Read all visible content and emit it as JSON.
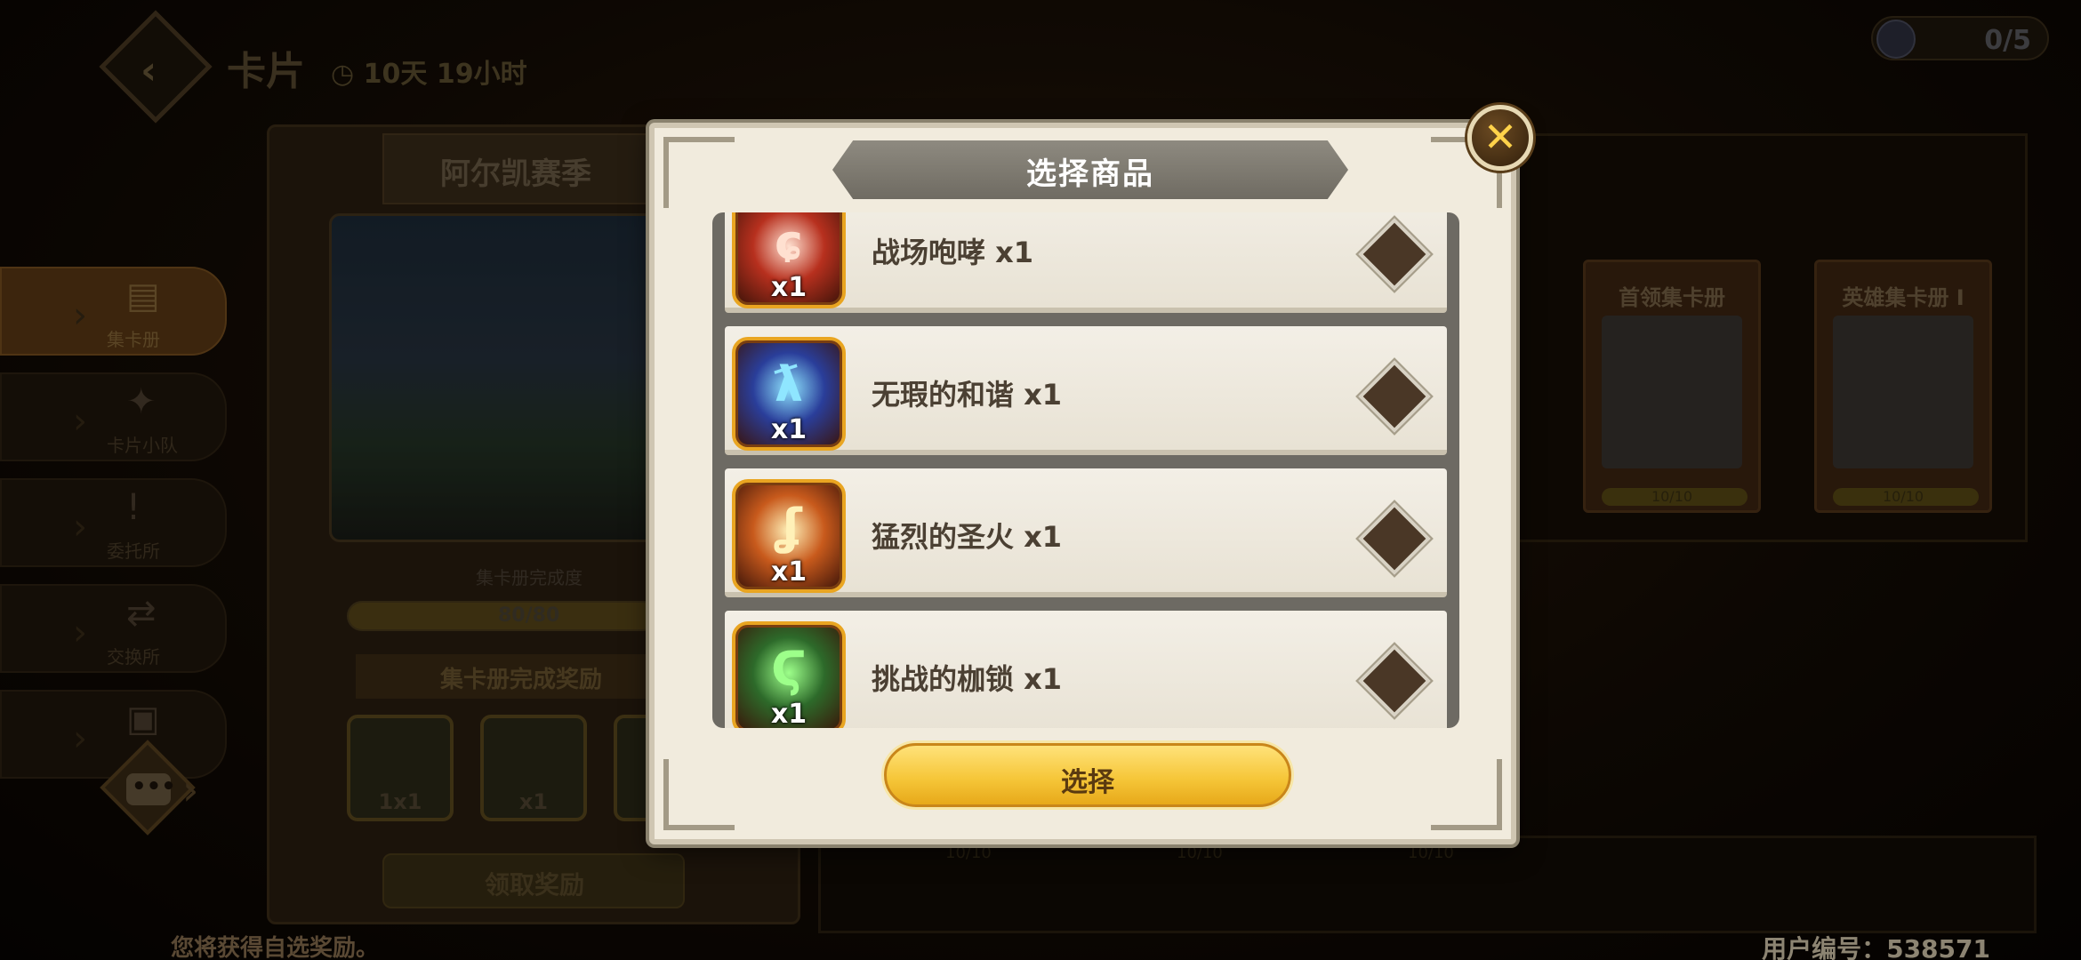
{
  "background": {
    "title": "卡片",
    "timer": "10天 19小时",
    "counter": "0/5",
    "season_name": "阿尔凯赛季",
    "progress_label": "集卡册完成度",
    "progress_value": "80/80",
    "progress_fraction": 1.0,
    "reward_banner": "集卡册完成奖励",
    "reward_slots": [
      "1x1",
      "x1",
      "x"
    ],
    "claim_button": "领取奖励",
    "side_menu": [
      {
        "label": "集卡册",
        "icon": "card-album-icon",
        "glyph": "▤",
        "active": true
      },
      {
        "label": "卡片小队",
        "icon": "card-team-icon",
        "glyph": "✦",
        "active": false
      },
      {
        "label": "委托所",
        "icon": "commission-icon",
        "glyph": "!",
        "active": false
      },
      {
        "label": "交换所",
        "icon": "exchange-icon",
        "glyph": "⇄",
        "active": false
      },
      {
        "label": "",
        "icon": "misc-icon",
        "glyph": "▣",
        "active": false
      }
    ],
    "albums": [
      {
        "title": "首领集卡册",
        "progress": "10/10"
      },
      {
        "title": "英雄集卡册 I",
        "progress": "10/10"
      }
    ],
    "bottom_shelf_progress": [
      "10/10",
      "10/10",
      "10/10"
    ],
    "bottom_hint": "您将获得自选奖励。",
    "user_id": "用户编号：538571"
  },
  "modal": {
    "title": "选择商品",
    "close_label": "✕",
    "select_button": "选择",
    "items": [
      {
        "name": "战场咆哮 x1",
        "qty": "x1",
        "glyph": "ɕ",
        "icon": "battle-roar-icon",
        "glyph_color": "#ffe0d0",
        "bg": "#b7301e"
      },
      {
        "name": "无瑕的和谐 x1",
        "qty": "x1",
        "glyph": "ƛ",
        "icon": "flawless-harmony-icon",
        "glyph_color": "#8fe6ff",
        "bg": "#2a3e9a"
      },
      {
        "name": "猛烈的圣火 x1",
        "qty": "x1",
        "glyph": "ʆ",
        "icon": "fierce-holy-fire-icon",
        "glyph_color": "#fff1b8",
        "bg": "#c85a1c"
      },
      {
        "name": "挑战的枷锁 x1",
        "qty": "x1",
        "glyph": "Ϛ",
        "icon": "challenge-shackles-icon",
        "glyph_color": "#9dff8a",
        "bg": "#2d6a2a"
      }
    ]
  },
  "colors": {
    "accent_gold": "#f6c73a",
    "frame_icon_border": "#e9a521",
    "select_diamond": "#4a3726"
  }
}
